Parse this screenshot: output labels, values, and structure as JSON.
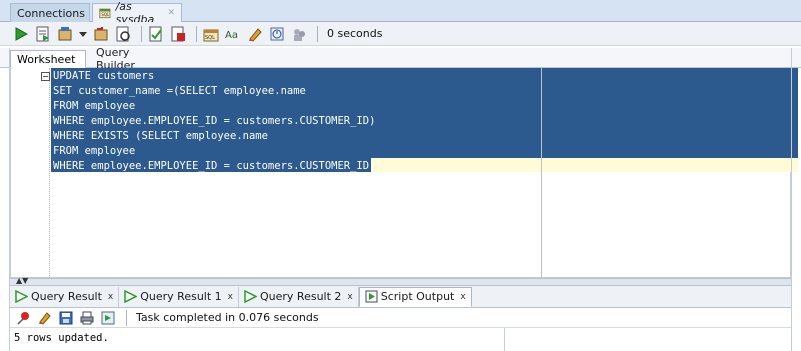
{
  "doc_tabs": [
    {
      "label": "Connections"
    },
    {
      "label": "/as sysdba"
    }
  ],
  "toolbar": {
    "buttons": [
      "run-statement-icon",
      "run-script-icon",
      "commit-icon",
      "dropdown-icon",
      "rollback-icon",
      "explain-plan-icon",
      "autotrace-icon",
      "sql-tuning-icon",
      "format-icon",
      "clear-icon",
      "history-icon",
      "unshared-worksheet-icon"
    ],
    "elapsed": "0 seconds"
  },
  "worksheet_tabs": [
    {
      "label": "Worksheet"
    },
    {
      "label": "Query Builder"
    }
  ],
  "editor": {
    "lines": [
      "UPDATE customers",
      "SET customer_name =(SELECT employee.name",
      "FROM employee",
      "WHERE employee.EMPLOYEE_ID = customers.CUSTOMER_ID)",
      "WHERE EXISTS (SELECT employee.name",
      "FROM employee",
      "WHERE employee.EMPLOYEE_ID = customers.CUSTOMER_ID);"
    ],
    "fold_marker": "−"
  },
  "result_tabs": [
    {
      "label": "Query Result",
      "close": "x"
    },
    {
      "label": "Query Result 1",
      "close": "x"
    },
    {
      "label": "Query Result 2",
      "close": "x"
    },
    {
      "label": "Script Output",
      "close": "x"
    }
  ],
  "output_toolbar": {
    "status": "Task completed in 0.076 seconds"
  },
  "output": {
    "text": "5 rows updated."
  },
  "colors": {
    "selection": "#2d5a8e",
    "current_line": "#fffbd6",
    "run_green": "#2e9b2e"
  }
}
